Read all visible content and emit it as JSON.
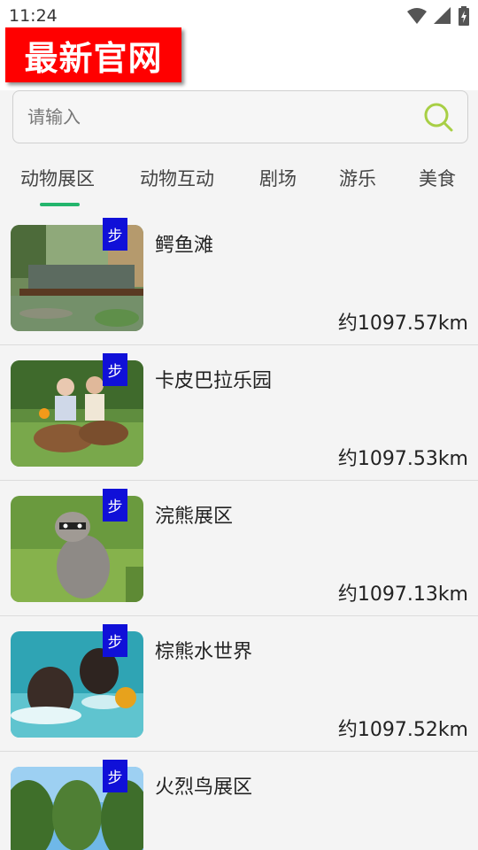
{
  "status": {
    "time": "11:24"
  },
  "header": {
    "logo_text": "最新官网"
  },
  "search": {
    "placeholder": "请输入"
  },
  "tabs": [
    {
      "label": "动物展区"
    },
    {
      "label": "动物互动"
    },
    {
      "label": "剧场"
    },
    {
      "label": "游乐"
    },
    {
      "label": "美食"
    }
  ],
  "list": {
    "badge_label": "步",
    "items": [
      {
        "title": "鳄鱼滩",
        "distance": "约1097.57km",
        "image": "crocodile-beach-photo"
      },
      {
        "title": "卡皮巴拉乐园",
        "distance": "约1097.53km",
        "image": "capybara-park-photo"
      },
      {
        "title": "浣熊展区",
        "distance": "约1097.13km",
        "image": "raccoon-exhibit-photo"
      },
      {
        "title": "棕熊水世界",
        "distance": "约1097.52km",
        "image": "brown-bear-water-photo"
      },
      {
        "title": "火烈鸟展区",
        "distance": "",
        "image": "flamingo-exhibit-photo"
      }
    ]
  },
  "colors": {
    "accent": "#23b56c",
    "logo_bg": "#ff0000",
    "badge_bg": "#1010d8",
    "search_icon": "#a8cf45"
  }
}
